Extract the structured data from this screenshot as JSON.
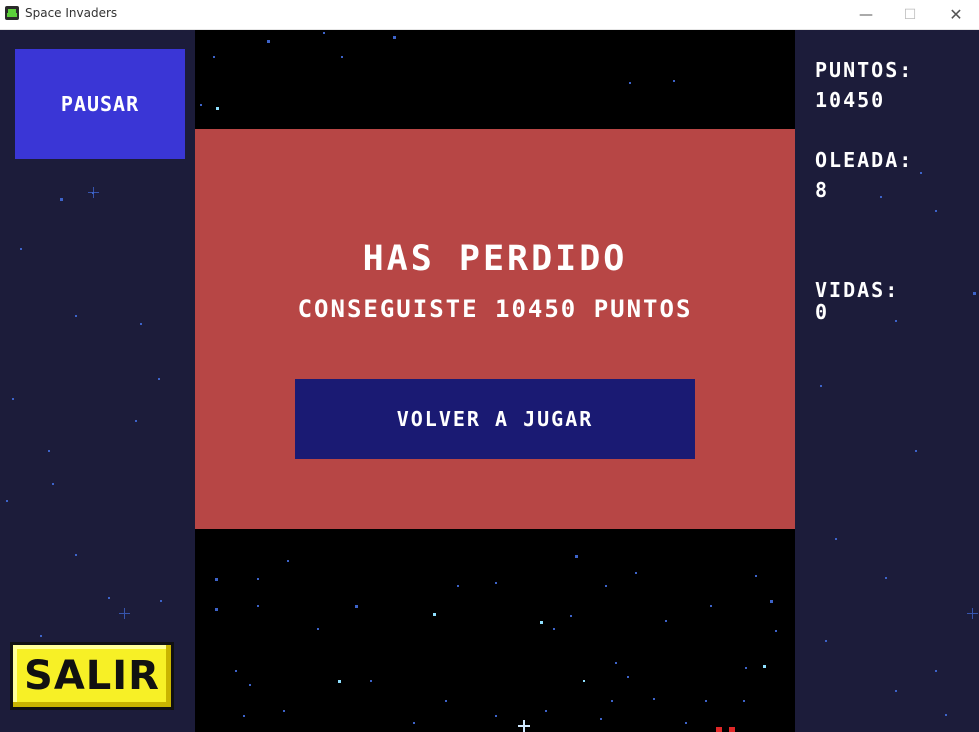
{
  "window": {
    "title": "Space Invaders",
    "minimize_glyph": "—",
    "maximize_glyph": "☐",
    "close_glyph": "✕"
  },
  "controls": {
    "pause_label": "PAUSAR",
    "exit_label": "SALIR"
  },
  "stats": {
    "points_label": "PUNTOS:",
    "points_value": "10450",
    "wave_label": "OLEADA:",
    "wave_value": "8",
    "lives_label": "VIDAS:",
    "lives_value": "0"
  },
  "game_over": {
    "title": "HAS PERDIDO",
    "score_message": "CONSEGUISTE 10450 PUNTOS",
    "replay_label": "VOLVER A JUGAR"
  },
  "colors": {
    "side_panel": "#1c1c3a",
    "game_background": "#000000",
    "overlay": "#b74645",
    "pause_button": "#3a36d6",
    "replay_button": "#1a1a73",
    "exit_button": "#f7f026",
    "star_blue": "#3d63c9",
    "star_cyan": "#8fe0ff"
  }
}
